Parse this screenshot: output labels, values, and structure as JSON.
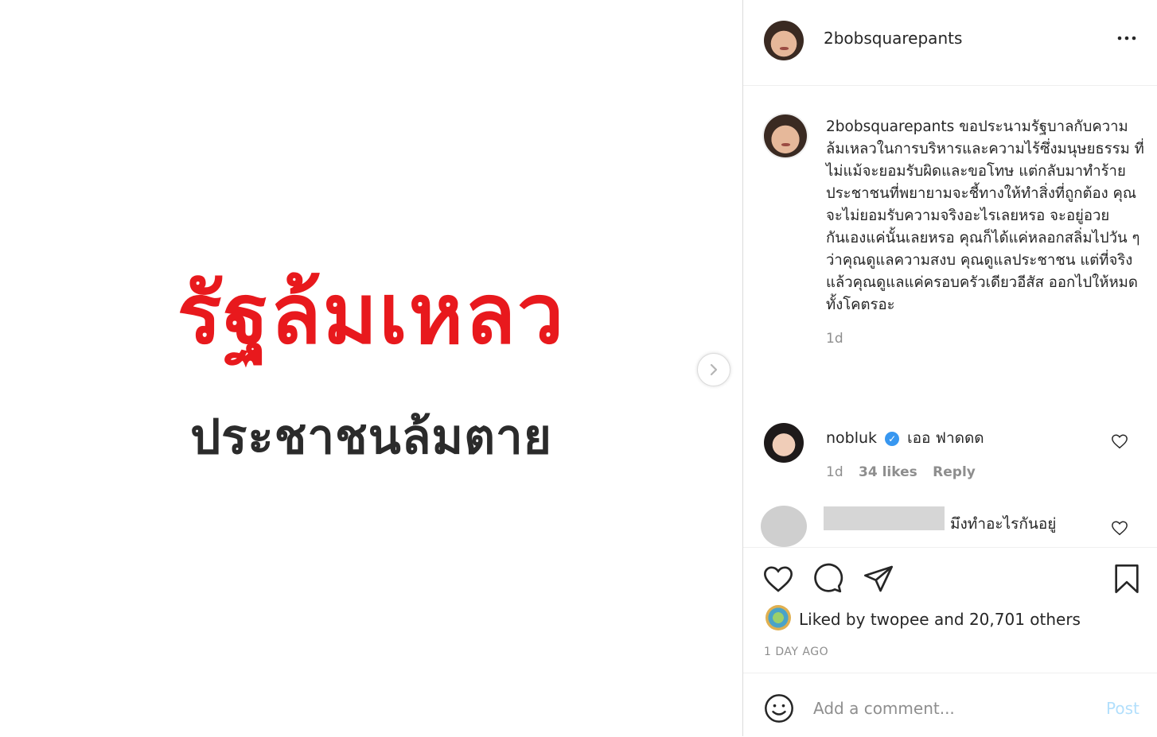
{
  "post_image": {
    "main_text": "รัฐล้มเหลว",
    "sub_text": "ประชาชนล้มตาย",
    "main_color": "#e8191d",
    "sub_color": "#2b2b2b"
  },
  "next_icon": "chevron-right-icon",
  "header": {
    "username": "2bobsquarepants",
    "more_icon": "more-horizontal-icon"
  },
  "caption": {
    "username": "2bobsquarepants",
    "text": "ขอประนามรัฐบาลกับความล้มเหลวในการบริหารและความไร้ซึ่งมนุษยธรรม ที่ไม่แม้จะยอมรับผิดและขอโทษ แต่กลับมาทำร้ายประชาชนที่พยายามจะชี้ทางให้ทำสิ่งที่ถูกต้อง คุณจะไม่ยอมรับความจริงอะไรเลยหรอ จะอยู่อวยกันเองแค่นั้นเลยหรอ คุณก็ได้แค่หลอกสลิ่มไปวัน ๆ ว่าคุณดูแลความสงบ คุณดูแลประชาชน แต่ที่จริงแล้วคุณดูแลแค่ครอบครัวเดียวอีสัส ออกไปให้หมด ทั้งโคตรอะ",
    "time": "1d"
  },
  "comments": [
    {
      "username": "nobluk",
      "verified": true,
      "text": "เออ ฟาดดด",
      "time": "1d",
      "likes": "34 likes",
      "reply": "Reply"
    },
    {
      "username": "",
      "text": "มึงทำอะไรกันอยู่"
    }
  ],
  "actions": {
    "like_icon": "heart-icon",
    "comment_icon": "comment-icon",
    "share_icon": "send-icon",
    "save_icon": "bookmark-icon",
    "liked_by_prefix": "Liked by",
    "liked_by_user": "twopee",
    "and_text": "and",
    "others": "20,701 others",
    "time_ago": "1 DAY AGO"
  },
  "add_comment": {
    "emoji_icon": "smiley-icon",
    "placeholder": "Add a comment...",
    "post_label": "Post"
  }
}
